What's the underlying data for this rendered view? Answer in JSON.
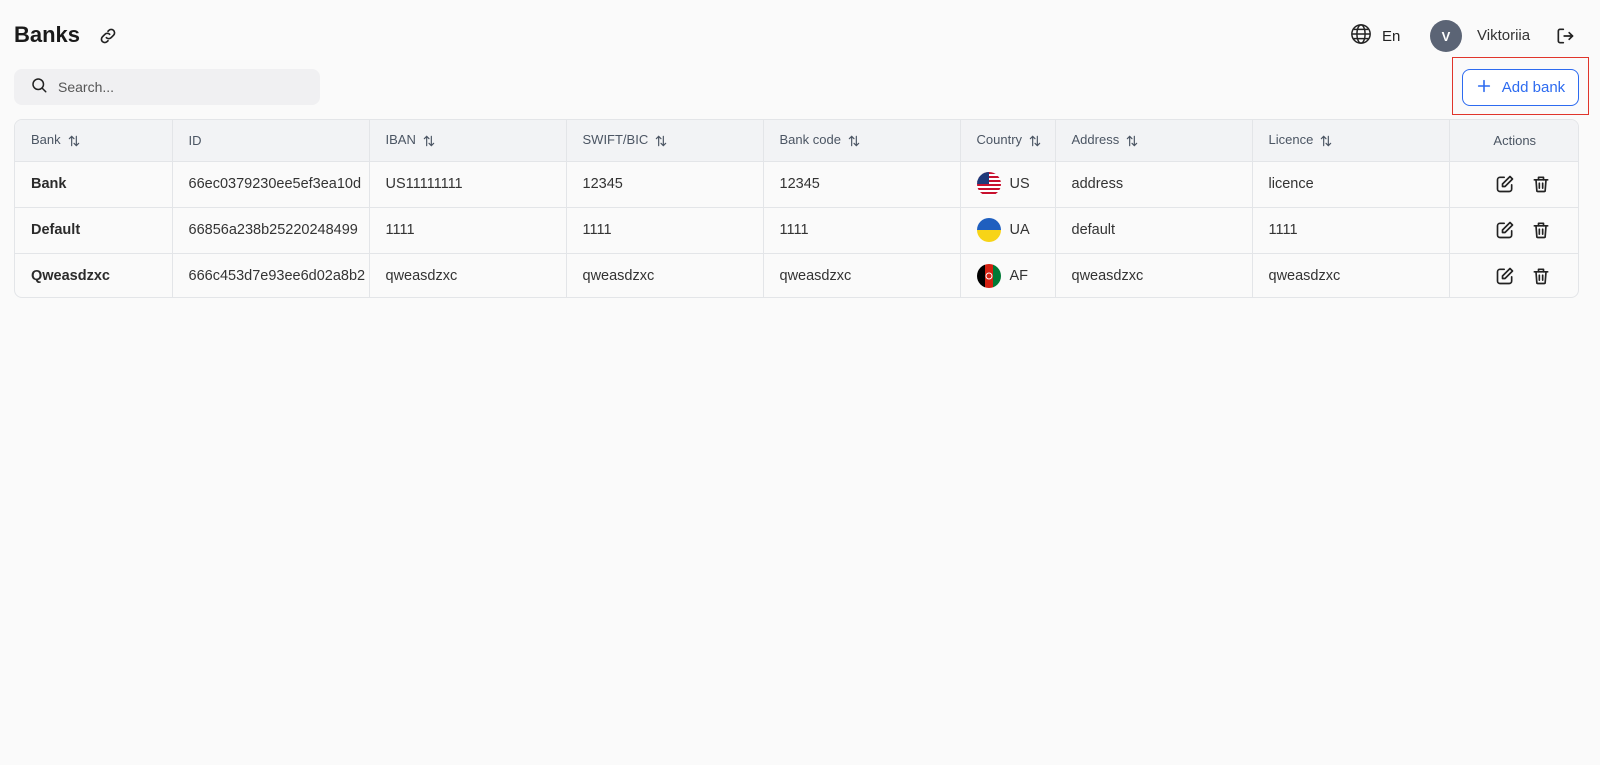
{
  "header": {
    "title": "Banks",
    "language": "En",
    "avatar_initial": "V",
    "user_name": "Viktoriia"
  },
  "search": {
    "placeholder": "Search..."
  },
  "toolbar": {
    "add_label": "Add bank"
  },
  "table": {
    "columns": [
      "Bank",
      "ID",
      "IBAN",
      "SWIFT/BIC",
      "Bank code",
      "Country",
      "Address",
      "Licence",
      "Actions"
    ],
    "rows": [
      {
        "bank": "Bank",
        "id": "66ec0379230ee5ef3ea10d",
        "iban": "US11111111",
        "swift": "12345",
        "bank_code": "12345",
        "country": "US",
        "flag": "us-flag-icon",
        "address": "address",
        "licence": "licence"
      },
      {
        "bank": "Default",
        "id": "66856a238b25220248499",
        "iban": "1111",
        "swift": "1111",
        "bank_code": "1111",
        "country": "UA",
        "flag": "ua-flag-icon",
        "address": "default",
        "licence": "1111"
      },
      {
        "bank": "Qweasdzxc",
        "id": "666c453d7e93ee6d02a8b2",
        "iban": "qweasdzxc",
        "swift": "qweasdzxc",
        "bank_code": "qweasdzxc",
        "country": "AF",
        "flag": "af-flag-icon",
        "address": "qweasdzxc",
        "licence": "qweasdzxc"
      }
    ]
  },
  "colors": {
    "accent": "#2d6bf0",
    "highlight": "#e0352b",
    "avatar_bg": "#5b6475"
  }
}
